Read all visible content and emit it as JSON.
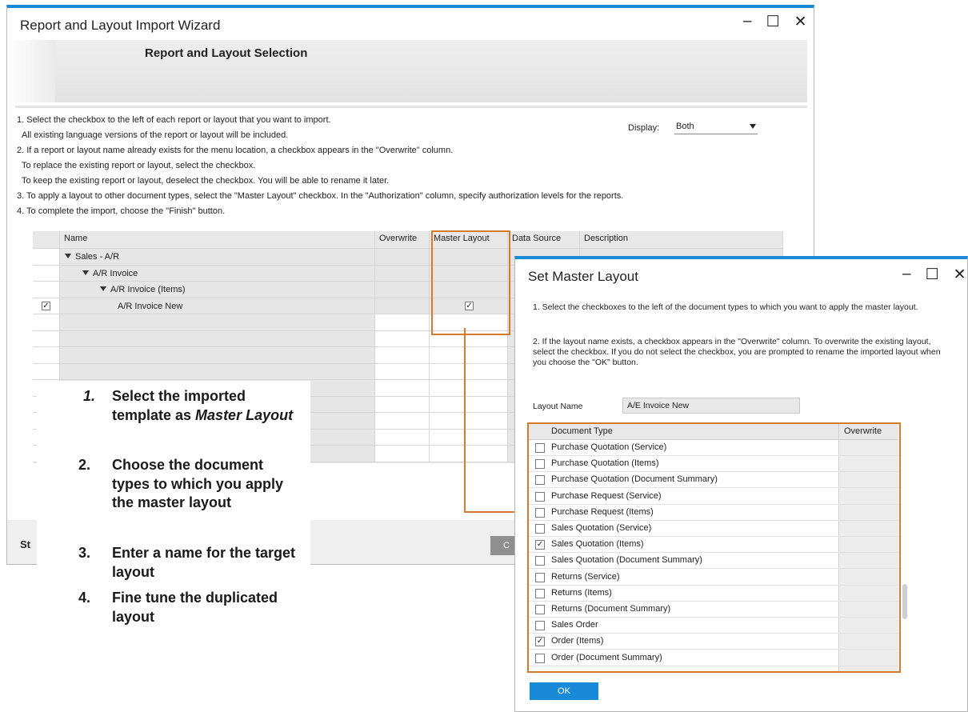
{
  "main_window": {
    "title": "Report and Layout Import Wizard",
    "controls": "_ ☐ ✕",
    "step_title": "Report and Layout Selection",
    "instructions": [
      "1. Select the checkbox to the left of each report or layout that you want to import.",
      "All existing language versions of the report or layout will be included.",
      "2. If a report or layout name already exists for the menu location, a checkbox appears in the \"Overwrite\" column.",
      "To replace the existing report or layout, select the checkbox.",
      "To keep the existing report or layout, deselect the checkbox. You will be able to rename it later.",
      "3. To apply a layout to other document types, select the \"Master Layout\" checkbox. In the \"Authorization\" column, specify authorization levels for the reports.",
      "4. To complete the import, choose the \"Finish\" button."
    ],
    "display_label": "Display:",
    "display_value": "Both",
    "columns": [
      "Name",
      "Overwrite",
      "Master Layout",
      "Data Source",
      "Description"
    ],
    "tree_rows": [
      {
        "label": "Sales - A/R",
        "level": 0,
        "expanded": true,
        "selected": false,
        "master_layout": false
      },
      {
        "label": "A/R Invoice",
        "level": 1,
        "expanded": true,
        "selected": false,
        "master_layout": false
      },
      {
        "label": "A/R Invoice (Items)",
        "level": 2,
        "expanded": true,
        "selected": false,
        "master_layout": false
      },
      {
        "label": "A/R Invoice New",
        "level": 3,
        "expanded": false,
        "selected": true,
        "master_layout": true
      }
    ],
    "bottom_left_text": "St",
    "bottom_button_partial": "C"
  },
  "callout": {
    "steps": [
      {
        "num": "1.",
        "text": "Select the imported template as ",
        "emph": "Master Layout"
      },
      {
        "num": "2.",
        "text": "Choose the document types to which you apply the master layout"
      },
      {
        "num": "3.",
        "text": "Enter a name for the target layout"
      },
      {
        "num": "4.",
        "text": "Fine tune the duplicated layout"
      }
    ]
  },
  "dialog": {
    "title": "Set Master Layout",
    "controls": "_ ☐ ✕",
    "instruction_1": "1. Select the checkboxes to the left of the document types to which you want to apply the master layout.",
    "instruction_2": "2. If the layout name exists, a checkbox appears in the \"Overwrite\" column. To overwrite the existing layout, select the checkbox. If you do not select the checkbox, you are prompted to rename the imported layout when you choose the \"OK\" button.",
    "layout_name_label": "Layout Name",
    "layout_name_value": "A/E Invoice New",
    "columns": [
      "Document Type",
      "Overwrite"
    ],
    "document_types": [
      {
        "label": "Purchase Quotation (Service)",
        "checked": false
      },
      {
        "label": "Purchase Quotation (Items)",
        "checked": false
      },
      {
        "label": "Purchase Quotation (Document Summary)",
        "checked": false
      },
      {
        "label": "Purchase Request (Service)",
        "checked": false
      },
      {
        "label": "Purchase Request (Items)",
        "checked": false
      },
      {
        "label": "Sales Quotation (Service)",
        "checked": false
      },
      {
        "label": "Sales Quotation (Items)",
        "checked": true
      },
      {
        "label": "Sales Quotation (Document Summary)",
        "checked": false
      },
      {
        "label": "Returns (Service)",
        "checked": false
      },
      {
        "label": "Returns (Items)",
        "checked": false
      },
      {
        "label": "Returns (Document Summary)",
        "checked": false
      },
      {
        "label": "Sales Order",
        "checked": false
      },
      {
        "label": "Order (Items)",
        "checked": true
      },
      {
        "label": "Order (Document Summary)",
        "checked": false
      }
    ],
    "ok_label": "OK"
  },
  "colors": {
    "accent_blue": "#1a8ad8",
    "highlight_orange": "#d77b2a",
    "grid_gray": "#e6e6e6"
  }
}
